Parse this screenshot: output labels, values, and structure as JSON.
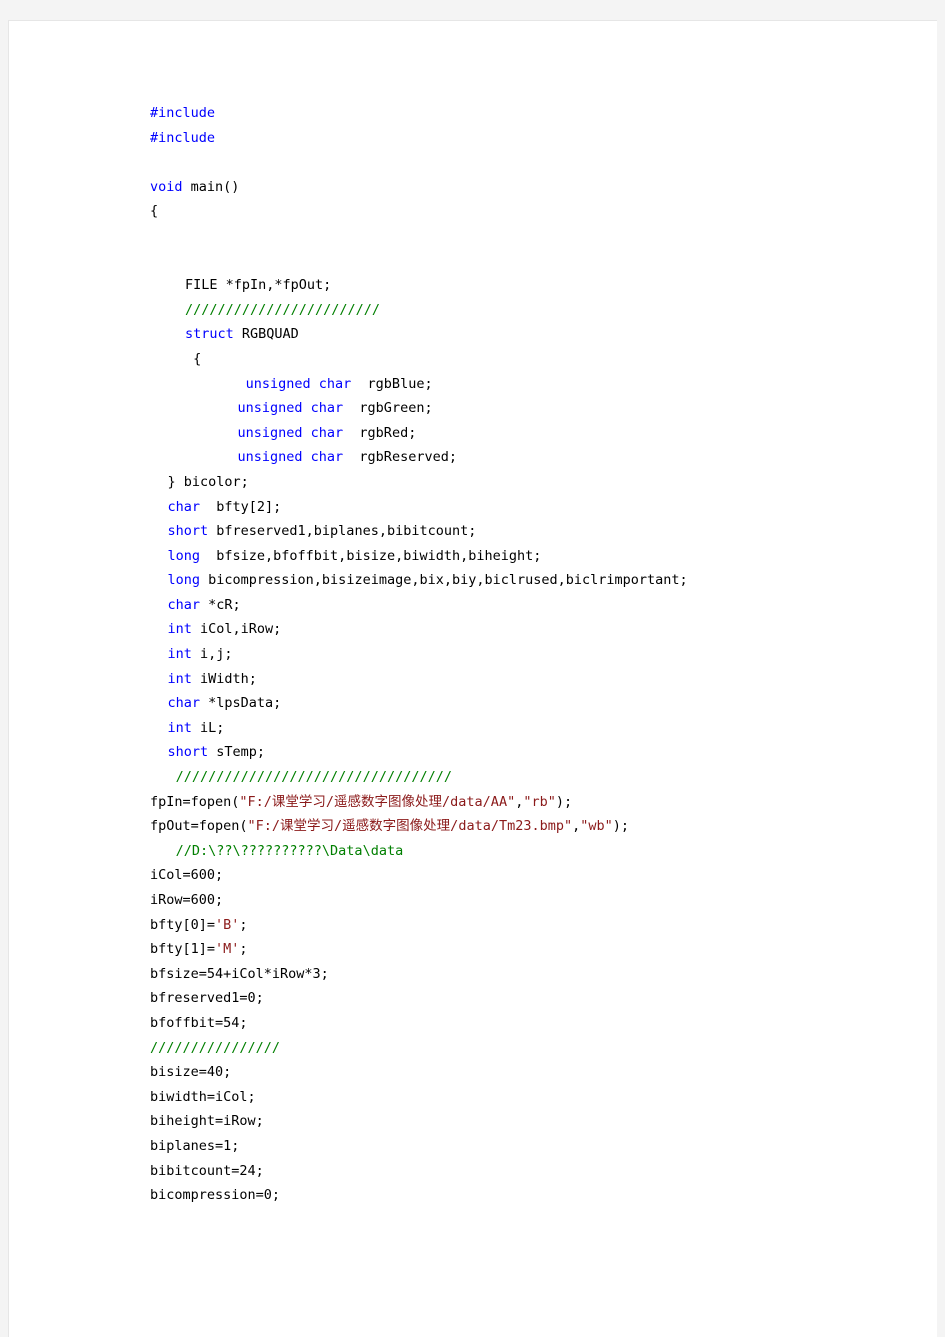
{
  "document": {
    "page_background": "#ffffff",
    "canvas_background": "#f4f4f4",
    "language": "c"
  },
  "syntax_colors": {
    "keyword": "#0000FF",
    "string": "#8B1A1A",
    "comment": "#007F00",
    "plain": "#000000"
  },
  "code": {
    "lines": [
      {
        "indent": 0,
        "tokens": [
          {
            "t": "kw",
            "v": "#include"
          }
        ]
      },
      {
        "indent": 0,
        "tokens": [
          {
            "t": "kw",
            "v": "#include"
          }
        ]
      },
      {
        "indent": 0,
        "tokens": []
      },
      {
        "indent": 0,
        "tokens": [
          {
            "t": "kw",
            "v": "void"
          },
          {
            "t": "pln",
            "v": " main()"
          }
        ]
      },
      {
        "indent": 0,
        "tokens": [
          {
            "t": "pln",
            "v": "{"
          }
        ]
      },
      {
        "indent": 0,
        "tokens": []
      },
      {
        "indent": 0,
        "tokens": []
      },
      {
        "indent": 2,
        "tokens": [
          {
            "t": "pln",
            "v": "FILE *fpIn,*fpOut;"
          }
        ]
      },
      {
        "indent": 2,
        "tokens": [
          {
            "t": "cmt",
            "v": "////////////////////////"
          }
        ]
      },
      {
        "indent": 2,
        "tokens": [
          {
            "t": "kw",
            "v": "struct"
          },
          {
            "t": "pln",
            "v": " RGBQUAD"
          }
        ]
      },
      {
        "indent": 2,
        "tokens": [
          {
            "t": "pln",
            "v": " {"
          }
        ]
      },
      {
        "indent": 5,
        "tokens": [
          {
            "t": "kw",
            "v": " unsigned char"
          },
          {
            "t": "pln",
            "v": "  rgbBlue;"
          }
        ]
      },
      {
        "indent": 5,
        "tokens": [
          {
            "t": "kw",
            "v": "unsigned char"
          },
          {
            "t": "pln",
            "v": "  rgbGreen;"
          }
        ]
      },
      {
        "indent": 5,
        "tokens": [
          {
            "t": "kw",
            "v": "unsigned char"
          },
          {
            "t": "pln",
            "v": "  rgbRed;"
          }
        ]
      },
      {
        "indent": 5,
        "tokens": [
          {
            "t": "kw",
            "v": "unsigned char"
          },
          {
            "t": "pln",
            "v": "  rgbReserved;"
          }
        ]
      },
      {
        "indent": 1,
        "tokens": [
          {
            "t": "pln",
            "v": "} bicolor;"
          }
        ]
      },
      {
        "indent": 1,
        "tokens": [
          {
            "t": "kw",
            "v": "char"
          },
          {
            "t": "pln",
            "v": "  bfty[2];"
          }
        ]
      },
      {
        "indent": 1,
        "tokens": [
          {
            "t": "kw",
            "v": "short"
          },
          {
            "t": "pln",
            "v": " bfreserved1,biplanes,bibitcount;"
          }
        ]
      },
      {
        "indent": 1,
        "tokens": [
          {
            "t": "kw",
            "v": "long"
          },
          {
            "t": "pln",
            "v": "  bfsize,bfoffbit,bisize,biwidth,biheight;"
          }
        ]
      },
      {
        "indent": 1,
        "tokens": [
          {
            "t": "kw",
            "v": "long"
          },
          {
            "t": "pln",
            "v": " bicompression,bisizeimage,bix,biy,biclrused,biclrimportant;"
          }
        ]
      },
      {
        "indent": 1,
        "tokens": [
          {
            "t": "kw",
            "v": "char"
          },
          {
            "t": "pln",
            "v": " *cR;"
          }
        ]
      },
      {
        "indent": 1,
        "tokens": [
          {
            "t": "kw",
            "v": "int"
          },
          {
            "t": "pln",
            "v": " iCol,iRow;"
          }
        ]
      },
      {
        "indent": 1,
        "tokens": [
          {
            "t": "kw",
            "v": "int"
          },
          {
            "t": "pln",
            "v": " i,j;"
          }
        ]
      },
      {
        "indent": 1,
        "tokens": [
          {
            "t": "kw",
            "v": "int"
          },
          {
            "t": "pln",
            "v": " iWidth;"
          }
        ]
      },
      {
        "indent": 1,
        "tokens": [
          {
            "t": "kw",
            "v": "char"
          },
          {
            "t": "pln",
            "v": " *lpsData;"
          }
        ]
      },
      {
        "indent": 1,
        "tokens": [
          {
            "t": "kw",
            "v": "int"
          },
          {
            "t": "pln",
            "v": " iL;"
          }
        ]
      },
      {
        "indent": 1,
        "tokens": [
          {
            "t": "kw",
            "v": "short"
          },
          {
            "t": "pln",
            "v": " sTemp;"
          }
        ]
      },
      {
        "indent": 1,
        "tokens": [
          {
            "t": "cmt",
            "v": " //////////////////////////////////"
          }
        ]
      },
      {
        "indent": 0,
        "tokens": [
          {
            "t": "pln",
            "v": "fpIn=fopen("
          },
          {
            "t": "str",
            "v": "\"F:/课堂学习/遥感数字图像处理/data/AA\""
          },
          {
            "t": "pln",
            "v": ","
          },
          {
            "t": "str",
            "v": "\"rb\""
          },
          {
            "t": "pln",
            "v": ");"
          }
        ]
      },
      {
        "indent": 0,
        "tokens": [
          {
            "t": "pln",
            "v": "fpOut=fopen("
          },
          {
            "t": "str",
            "v": "\"F:/课堂学习/遥感数字图像处理/data/Tm23.bmp\""
          },
          {
            "t": "pln",
            "v": ","
          },
          {
            "t": "str",
            "v": "\"wb\""
          },
          {
            "t": "pln",
            "v": ");"
          }
        ]
      },
      {
        "indent": 1,
        "tokens": [
          {
            "t": "cmt",
            "v": " //D:\\??\\??????????\\Data\\data"
          }
        ]
      },
      {
        "indent": 0,
        "tokens": [
          {
            "t": "pln",
            "v": "iCol=600;"
          }
        ]
      },
      {
        "indent": 0,
        "tokens": [
          {
            "t": "pln",
            "v": "iRow=600;"
          }
        ]
      },
      {
        "indent": 0,
        "tokens": [
          {
            "t": "pln",
            "v": "bfty[0]="
          },
          {
            "t": "str",
            "v": "'B'"
          },
          {
            "t": "pln",
            "v": ";"
          }
        ]
      },
      {
        "indent": 0,
        "tokens": [
          {
            "t": "pln",
            "v": "bfty[1]="
          },
          {
            "t": "str",
            "v": "'M'"
          },
          {
            "t": "pln",
            "v": ";"
          }
        ]
      },
      {
        "indent": 0,
        "tokens": [
          {
            "t": "pln",
            "v": "bfsize=54+iCol*iRow*3;"
          }
        ]
      },
      {
        "indent": 0,
        "tokens": [
          {
            "t": "pln",
            "v": "bfreserved1=0;"
          }
        ]
      },
      {
        "indent": 0,
        "tokens": [
          {
            "t": "pln",
            "v": "bfoffbit=54;"
          }
        ]
      },
      {
        "indent": 0,
        "tokens": [
          {
            "t": "cmt",
            "v": "////////////////"
          }
        ]
      },
      {
        "indent": 0,
        "tokens": [
          {
            "t": "pln",
            "v": "bisize=40;"
          }
        ]
      },
      {
        "indent": 0,
        "tokens": [
          {
            "t": "pln",
            "v": "biwidth=iCol;"
          }
        ]
      },
      {
        "indent": 0,
        "tokens": [
          {
            "t": "pln",
            "v": "biheight=iRow;"
          }
        ]
      },
      {
        "indent": 0,
        "tokens": [
          {
            "t": "pln",
            "v": "biplanes=1;"
          }
        ]
      },
      {
        "indent": 0,
        "tokens": [
          {
            "t": "pln",
            "v": "bibitcount=24;"
          }
        ]
      },
      {
        "indent": 0,
        "tokens": [
          {
            "t": "pln",
            "v": "bicompression=0;"
          }
        ]
      }
    ]
  }
}
